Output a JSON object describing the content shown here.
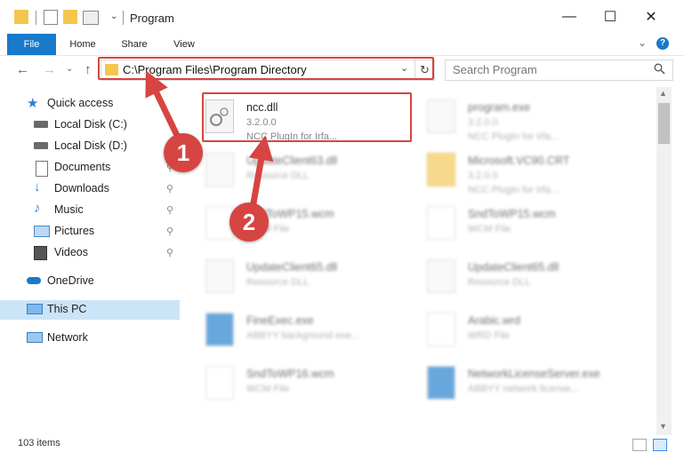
{
  "window": {
    "title": "Program",
    "minimize_glyph": "—",
    "maximize_glyph": "☐",
    "close_glyph": "✕"
  },
  "ribbon": {
    "tabs": [
      "File",
      "Home",
      "Share",
      "View"
    ],
    "help_glyph": "?",
    "expand_glyph": "⌄"
  },
  "address": {
    "path": "C:\\Program Files\\Program Directory",
    "dropdown_glyph": "⌄",
    "refresh_glyph": "↻",
    "search_placeholder": "Search Program"
  },
  "nav_glyphs": {
    "back": "←",
    "forward": "→",
    "dropdown": "⌄",
    "up": "↑"
  },
  "sidebar": {
    "items": [
      {
        "label": "Quick access",
        "icon": "star-icon",
        "pinned": false
      },
      {
        "label": "Local Disk (C:)",
        "icon": "drive-icon",
        "pinned": false
      },
      {
        "label": "Local Disk (D:)",
        "icon": "drive-icon",
        "pinned": false
      },
      {
        "label": "Documents",
        "icon": "documents-icon",
        "pinned": true
      },
      {
        "label": "Downloads",
        "icon": "downloads-icon",
        "pinned": true
      },
      {
        "label": "Music",
        "icon": "music-icon",
        "pinned": true
      },
      {
        "label": "Pictures",
        "icon": "pictures-icon",
        "pinned": true
      },
      {
        "label": "Videos",
        "icon": "videos-icon",
        "pinned": true
      },
      {
        "label": "OneDrive",
        "icon": "cloud-icon",
        "pinned": false
      },
      {
        "label": "This PC",
        "icon": "computer-icon",
        "pinned": false
      },
      {
        "label": "Network",
        "icon": "network-icon",
        "pinned": false
      }
    ],
    "pin_glyph": "📌"
  },
  "files": [
    {
      "name": "ncc.dll",
      "type": "3.2.0.0",
      "desc": "NCC PlugIn for Irfa...",
      "blurred": false
    },
    {
      "name": "program.exe",
      "type": "3.2.0.0",
      "desc": "NCC PlugIn for Irfa...",
      "blurred": true
    },
    {
      "name": "UpdateClient63.dll",
      "type": "Resource DLL",
      "desc": "",
      "blurred": true
    },
    {
      "name": "Microsoft.VC90.CRT",
      "type": "3.2.0.0",
      "desc": "NCC PlugIn for Irfa...",
      "blurred": true
    },
    {
      "name": "SndToWP15.wcm",
      "type": "WCM File",
      "desc": "",
      "blurred": true
    },
    {
      "name": "UpdateClient65.dll",
      "type": "Resource DLL",
      "desc": "",
      "blurred": true
    },
    {
      "name": "UpdateClient65.dll",
      "type": "Resource DLL",
      "desc": "",
      "blurred": true
    },
    {
      "name": "FineExec.exe",
      "type": "ABBYY background exe...",
      "desc": "",
      "blurred": true
    },
    {
      "name": "Arabic.wrd",
      "type": "WRD File",
      "desc": "",
      "blurred": true
    },
    {
      "name": "SndToWP16.wcm",
      "type": "WCM File",
      "desc": "",
      "blurred": true
    },
    {
      "name": "NetworkLicenseServer.exe",
      "type": "ABBYY network license...",
      "desc": "",
      "blurred": true
    }
  ],
  "scroll_glyphs": {
    "up": "▲",
    "down": "▼"
  },
  "status": {
    "count": "103 items"
  },
  "annotations": {
    "step1": "1",
    "step2": "2"
  },
  "colors": {
    "accent": "#1979ca",
    "annotation": "#d64541",
    "selected_nav": "#cce4f7"
  }
}
